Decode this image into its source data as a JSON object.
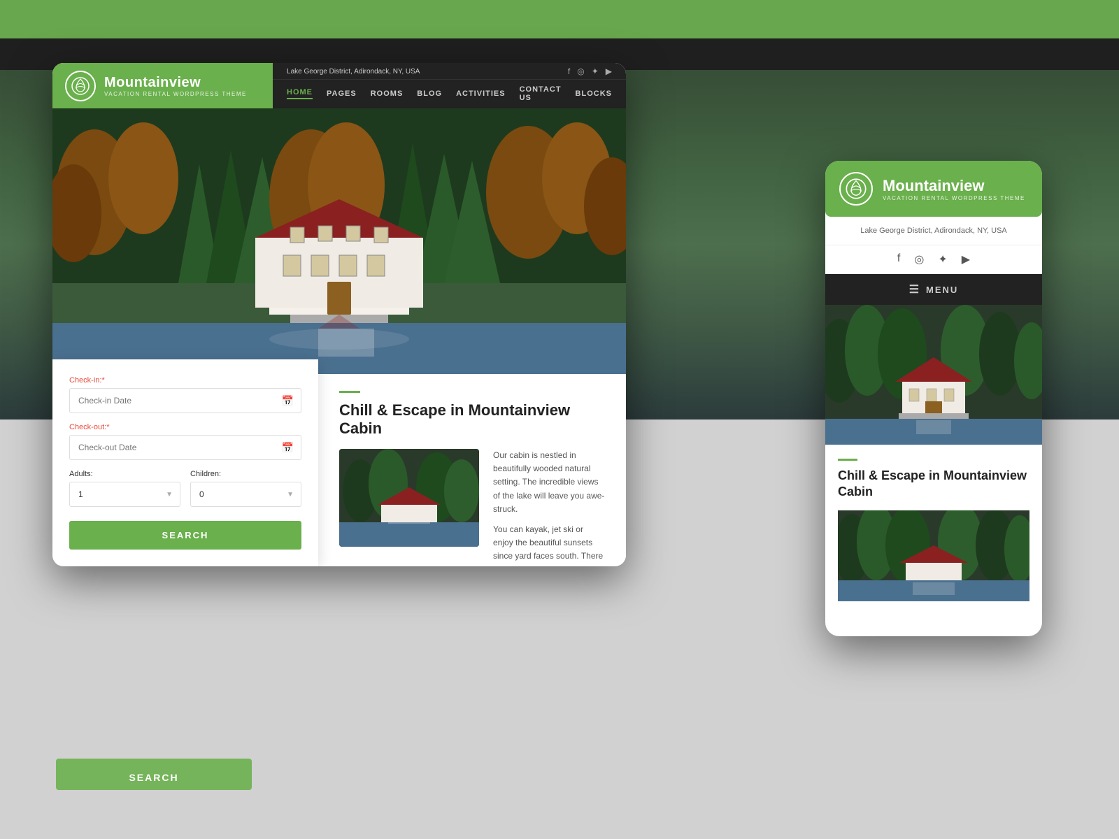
{
  "site": {
    "name": "Mountainview",
    "tagline": "VACATION RENTAL WORDPRESS THEME",
    "location": "Lake George District, Adirondack, NY, USA"
  },
  "nav": {
    "links": [
      {
        "label": "HOME",
        "active": true
      },
      {
        "label": "PAGES",
        "active": false
      },
      {
        "label": "ROOMS",
        "active": false
      },
      {
        "label": "BLOG",
        "active": false
      },
      {
        "label": "ACTIVITIES",
        "active": false
      },
      {
        "label": "CONTACT US",
        "active": false
      },
      {
        "label": "BLOCKS",
        "active": false
      }
    ]
  },
  "mobile_nav": {
    "menu_label": "MENU"
  },
  "booking": {
    "checkin_label": "Check-in:",
    "checkin_placeholder": "Check-in Date",
    "checkout_label": "Check-out:",
    "checkout_placeholder": "Check-out Date",
    "adults_label": "Adults:",
    "adults_value": "1",
    "children_label": "Children:",
    "children_value": "0",
    "search_button": "SEARCH"
  },
  "content": {
    "accent": "",
    "title": "Chill & Escape in Mountainview Cabin",
    "paragraph1": "Our cabin is nestled in beautifully wooded natural setting. The incredible views of the lake will leave you awe-struck.",
    "paragraph2": "You can kayak, jet ski or enjoy the beautiful sunsets since yard faces south. There is groceries, different tours and many am..."
  },
  "mobile_content": {
    "title": "Chill & Escape in Mountainview Cabin"
  },
  "social": {
    "icons": [
      "f",
      "◎",
      "✦",
      "▶"
    ]
  }
}
